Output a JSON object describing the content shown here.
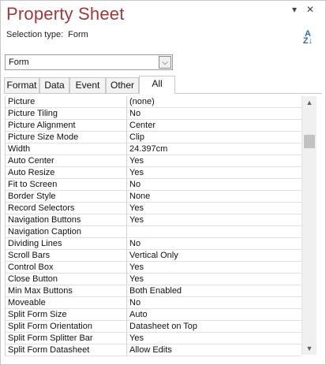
{
  "window": {
    "title": "Property Sheet",
    "dropdown_glyph": "▾",
    "close_glyph": "✕"
  },
  "selection": {
    "label": "Selection type:",
    "value": "Form",
    "sort_icon_top": "A",
    "sort_icon_bottom": "Z↓"
  },
  "object_combo": {
    "value": "Form",
    "arrow": "⌵"
  },
  "tabs": [
    {
      "label": "Format"
    },
    {
      "label": "Data"
    },
    {
      "label": "Event"
    },
    {
      "label": "Other"
    },
    {
      "label": "All",
      "active": true
    }
  ],
  "properties": [
    {
      "name": "Picture",
      "value": "(none)"
    },
    {
      "name": "Picture Tiling",
      "value": "No"
    },
    {
      "name": "Picture Alignment",
      "value": "Center"
    },
    {
      "name": "Picture Size Mode",
      "value": "Clip"
    },
    {
      "name": "Width",
      "value": "24.397cm"
    },
    {
      "name": "Auto Center",
      "value": "Yes"
    },
    {
      "name": "Auto Resize",
      "value": "Yes"
    },
    {
      "name": "Fit to Screen",
      "value": "No"
    },
    {
      "name": "Border Style",
      "value": "None"
    },
    {
      "name": "Record Selectors",
      "value": "Yes"
    },
    {
      "name": "Navigation Buttons",
      "value": "Yes"
    },
    {
      "name": "Navigation Caption",
      "value": ""
    },
    {
      "name": "Dividing Lines",
      "value": "No"
    },
    {
      "name": "Scroll Bars",
      "value": "Vertical Only"
    },
    {
      "name": "Control Box",
      "value": "Yes"
    },
    {
      "name": "Close Button",
      "value": "Yes"
    },
    {
      "name": "Min Max Buttons",
      "value": "Both Enabled"
    },
    {
      "name": "Moveable",
      "value": "No"
    },
    {
      "name": "Split Form Size",
      "value": "Auto"
    },
    {
      "name": "Split Form Orientation",
      "value": "Datasheet on Top"
    },
    {
      "name": "Split Form Splitter Bar",
      "value": "Yes"
    },
    {
      "name": "Split Form Datasheet",
      "value": "Allow Edits"
    }
  ],
  "scrollbar": {
    "up": "▲",
    "down": "▼",
    "position": 0.12
  }
}
